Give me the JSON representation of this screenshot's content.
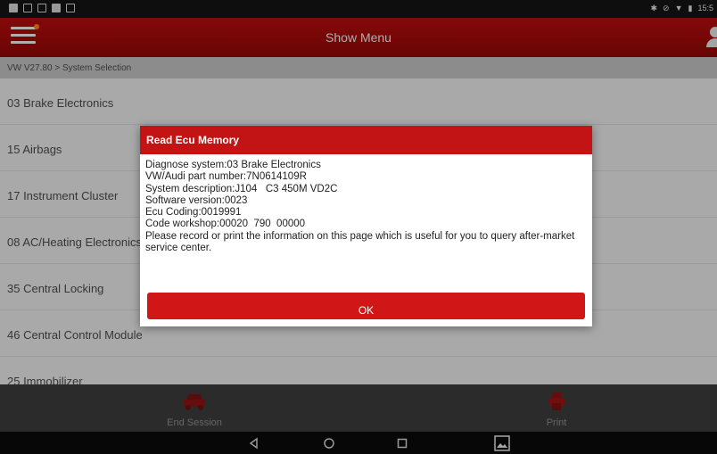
{
  "status_bar": {
    "left_icons": [
      "notification-icon",
      "notification-icon",
      "usb-icon",
      "notification-icon",
      "notification-icon"
    ],
    "right_icons": [
      "bluetooth-icon",
      "alarm-icon",
      "wifi-icon",
      "battery-icon"
    ],
    "time": "15:5"
  },
  "header": {
    "menu_icon": "hamburger-menu-icon",
    "title": "Show Menu",
    "user_icon": "user-icon"
  },
  "breadcrumb": "VW V27.80 > System Selection",
  "systems": [
    {
      "label": "03 Brake Electronics"
    },
    {
      "label": "15 Airbags"
    },
    {
      "label": "17 Instrument Cluster"
    },
    {
      "label": "08 AC/Heating Electronics"
    },
    {
      "label": "35 Central Locking"
    },
    {
      "label": "46 Central Control Module"
    },
    {
      "label": "25 Immobilizer"
    }
  ],
  "bottom_bar": {
    "end_session_label": "End Session",
    "print_label": "Print"
  },
  "dialog": {
    "title": "Read Ecu Memory",
    "lines": [
      "Diagnose system:03 Brake Electronics",
      "VW/Audi part number:7N0614109R",
      "System description:J104   C3 450M VD2C",
      "Software version:0023",
      "Ecu Coding:0019991",
      "Code workshop:00020  790  00000",
      "Please record or print the information on this page which is useful for you to query after-market service center."
    ],
    "ok_label": "OK"
  },
  "colors": {
    "header_red": "#a80a0a",
    "dialog_red": "#c21414",
    "button_red": "#d01616"
  }
}
